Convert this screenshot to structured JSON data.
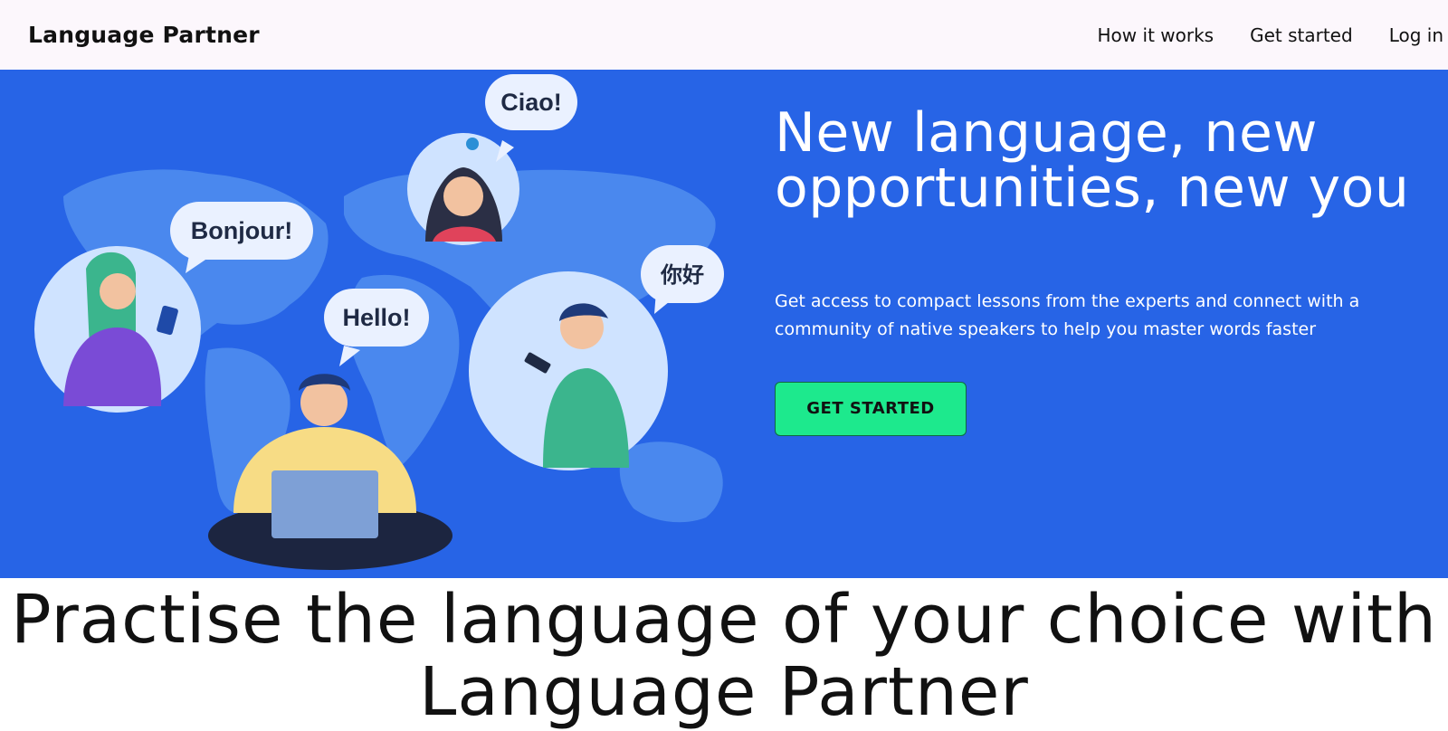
{
  "navbar": {
    "brand": "Language Partner",
    "links": [
      "How it works",
      "Get started",
      "Log in"
    ]
  },
  "hero": {
    "title_line1": "New language, new",
    "title_line2": "opportunities, new you",
    "subtitle": "Get access to compact lessons from the experts and connect with a community of native speakers to help you master words faster",
    "cta_label": "GET STARTED",
    "bubbles": {
      "ciao": "Ciao!",
      "bonjour": "Bonjour!",
      "hello": "Hello!",
      "nihao": "你好"
    }
  },
  "section": {
    "tagline": "Practise the language of your choice with Language Partner"
  },
  "colors": {
    "hero_bg": "#2764e6",
    "cta_bg": "#1de98d",
    "nav_bg": "#fcf7fc"
  }
}
